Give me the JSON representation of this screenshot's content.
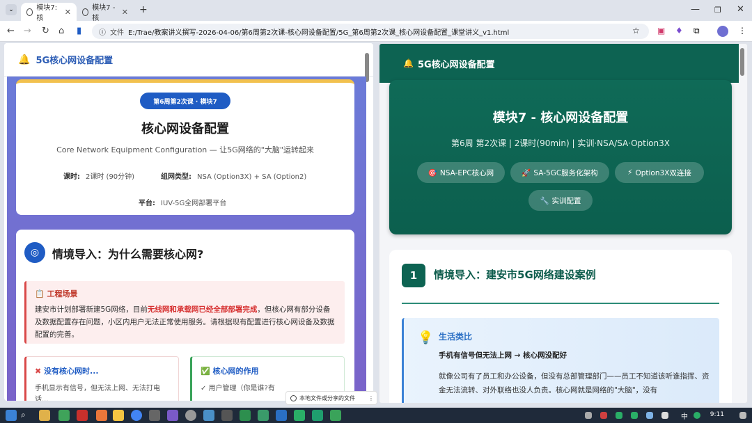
{
  "browser": {
    "tabs": [
      {
        "label": "模块7: 核"
      },
      {
        "label": "模块7 - 核"
      }
    ],
    "new_tab": "+",
    "url_chip": "文件",
    "url": "E:/Trae/教案讲义撰写-2026-04-06/第6周第2次课-核心网设备配置/5G_第6周第2次课_核心网设备配置_课堂讲义_v1.html"
  },
  "left": {
    "header_title": "5G核心网设备配置",
    "badge": "第6周第2次课 · 模块7",
    "hero_title": "核心网设备配置",
    "hero_subtitle": "Core Network Equipment Configuration — 让5G网络的\"大脑\"运转起来",
    "meta": [
      {
        "label": "课时:",
        "value": "2课时 (90分钟)"
      },
      {
        "label": "组网类型:",
        "value": "NSA (Option3X) + SA (Option2)"
      },
      {
        "label": "平台:",
        "value": "IUV-5G全网部署平台"
      }
    ],
    "section_title": "情境导入：为什么需要核心网?",
    "scene": {
      "heading": "工程场景",
      "text_before": "建安市计划部署新建5G网络，目前",
      "text_red": "无线网和承载网已经全部部署完成",
      "text_after": "，但核心网有部分设备及数据配置存在问题，小区内用户无法正常使用服务。请根据现有配置进行核心网设备及数据配置的完善。"
    },
    "card_without": {
      "heading": "没有核心网时...",
      "text": "手机显示有信号，但无法上网、无法打电话..."
    },
    "card_role": {
      "heading": "核心网的作用",
      "text": "✓ 用户管理（你是谁?有"
    }
  },
  "right": {
    "header_title": "5G核心网设备配置",
    "hero_title": "模块7 - 核心网设备配置",
    "hero_subtitle": "第6周 第2次课 | 2课时(90min) | 实训·NSA/SA·Option3X",
    "pills": [
      {
        "icon": "🎯",
        "label": "NSA-EPC核心网"
      },
      {
        "icon": "🚀",
        "label": "SA-5GC服务化架构"
      },
      {
        "icon": "⚡",
        "label": "Option3X双连接"
      },
      {
        "icon": "🔧",
        "label": "实训配置"
      }
    ],
    "section_number": "1",
    "section_title": "情境导入：建安市5G网络建设案例",
    "analogy": {
      "heading": "生活类比",
      "subheading": "手机有信号但无法上网 → 核心网没配好",
      "text": "就像公司有了员工和办公设备，但没有总部管理部门——员工不知道该听谁指挥、资金无法流转、对外联络也没人负责。核心网就是网络的\"大脑\"，没有"
    }
  },
  "toast": "本地文件或分享的文件",
  "taskbar": {
    "ime": "中",
    "time": "9:11"
  }
}
